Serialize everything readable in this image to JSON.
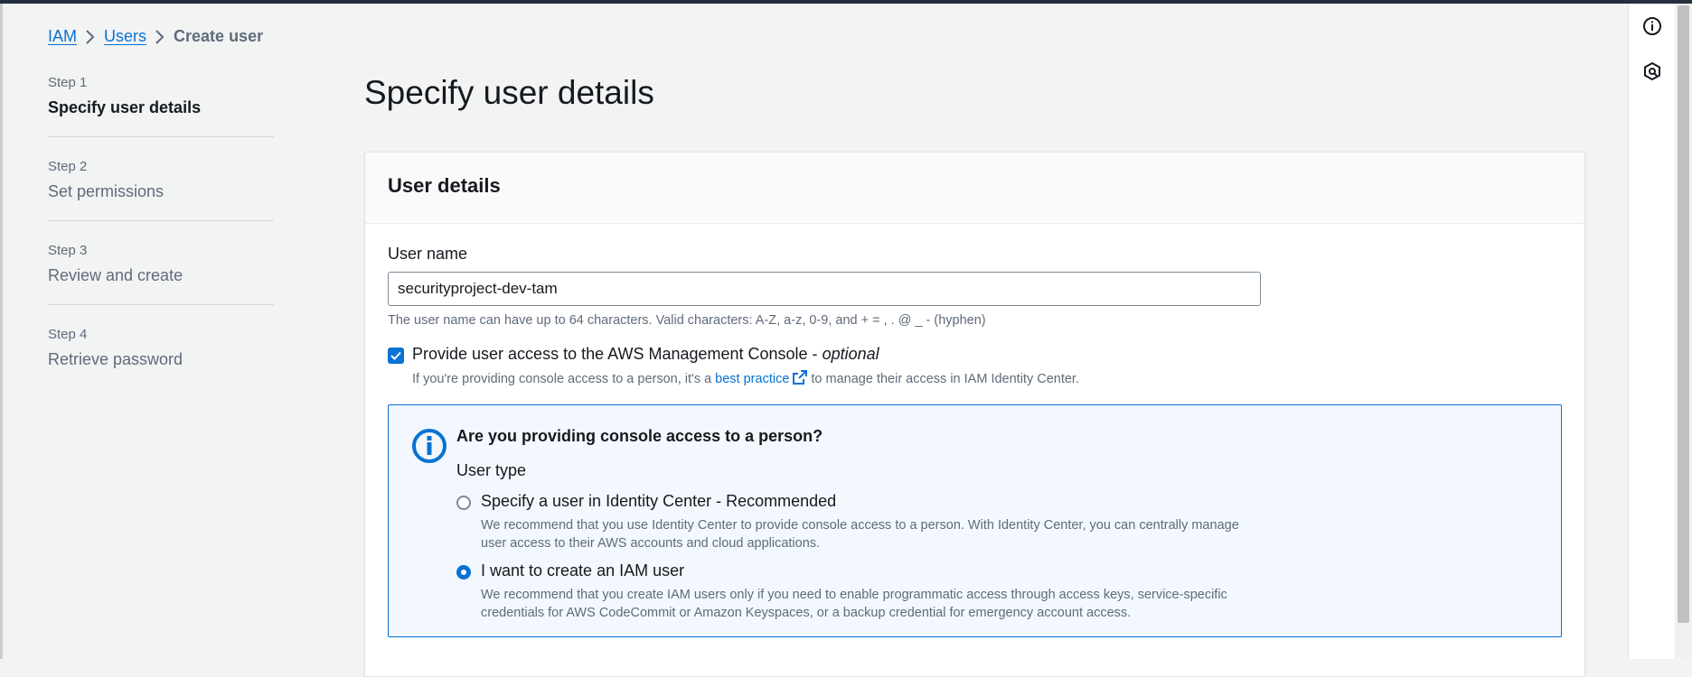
{
  "breadcrumb": {
    "items": [
      "IAM",
      "Users"
    ],
    "current": "Create user"
  },
  "steps": [
    {
      "num": "Step 1",
      "title": "Specify user details"
    },
    {
      "num": "Step 2",
      "title": "Set permissions"
    },
    {
      "num": "Step 3",
      "title": "Review and create"
    },
    {
      "num": "Step 4",
      "title": "Retrieve password"
    }
  ],
  "page": {
    "title": "Specify user details"
  },
  "card": {
    "title": "User details",
    "username_label": "User name",
    "username_value": "securityproject-dev-tam",
    "username_hint": "The user name can have up to 64 characters. Valid characters: A-Z, a-z, 0-9, and + = , . @ _ - (hyphen)",
    "console_checkbox": {
      "label": "Provide user access to the AWS Management Console - ",
      "optional": "optional",
      "checked": true,
      "desc_before": "If you're providing console access to a person, it's a",
      "desc_link": "best practice",
      "desc_after": "to manage their access in IAM Identity Center."
    },
    "info": {
      "title": "Are you providing console access to a person?",
      "user_type_label": "User type",
      "options": [
        {
          "label": "Specify a user in Identity Center - Recommended",
          "desc": "We recommend that you use Identity Center to provide console access to a person. With Identity Center, you can centrally manage user access to their AWS accounts and cloud applications.",
          "selected": false
        },
        {
          "label": "I want to create an IAM user",
          "desc": "We recommend that you create IAM users only if you need to enable programmatic access through access keys, service-specific credentials for AWS CodeCommit or Amazon Keyspaces, or a backup credential for emergency account access.",
          "selected": true
        }
      ]
    }
  },
  "rail": {
    "icons": [
      "info-icon",
      "feedback-icon"
    ]
  },
  "colors": {
    "accent": "#0972d3",
    "background": "#f2f3f3",
    "info_bg": "#f2f8fd"
  }
}
